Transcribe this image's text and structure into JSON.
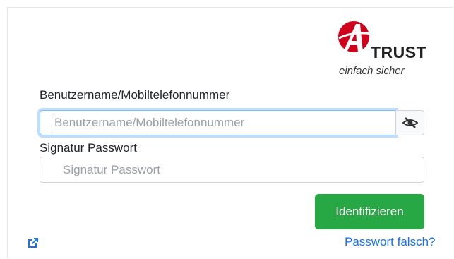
{
  "logo": {
    "brand": "TRUST",
    "tagline": "einfach sicher",
    "brand_color": "#d0021b"
  },
  "username": {
    "label": "Benutzername/Mobiltelefonnummer",
    "placeholder": "Benutzername/Mobiltelefonnummer",
    "value": "",
    "toggle_icon": "eye-slash-icon"
  },
  "password": {
    "label": "Signatur Passwort",
    "placeholder": "Signatur Passwort",
    "value": ""
  },
  "actions": {
    "submit_label": "Identifizieren",
    "submit_color": "#28a745",
    "external_icon": "external-link-icon",
    "forgot_label": "Passwort falsch?"
  }
}
